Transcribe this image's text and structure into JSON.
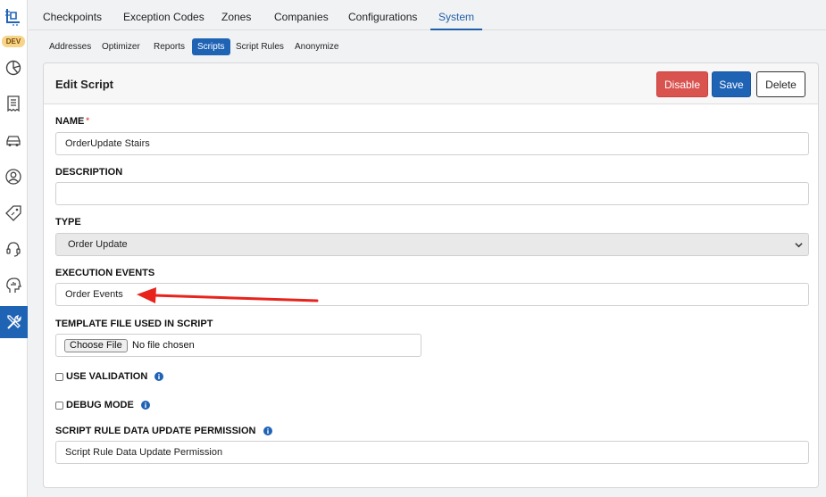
{
  "sidebar": {
    "badge": "DEV",
    "icons": [
      "logo-icon",
      "pie-chart-icon",
      "receipt-icon",
      "car-icon",
      "user-circle-icon",
      "price-tag-icon",
      "headset-icon",
      "head-analytics-icon",
      "tools-icon"
    ]
  },
  "top_tabs": [
    "Checkpoints",
    "Exception Codes",
    "Zones",
    "Companies",
    "Configurations",
    "System"
  ],
  "top_tabs_active": "System",
  "sub_tabs": [
    "Addresses",
    "Optimizer",
    "Reports",
    "Scripts",
    "Script Rules",
    "Anonymize"
  ],
  "sub_tabs_active": "Scripts",
  "card": {
    "title": "Edit Script",
    "disable_label": "Disable",
    "save_label": "Save",
    "delete_label": "Delete"
  },
  "form": {
    "name_label": "NAME",
    "name_required": "*",
    "name_value": "OrderUpdate Stairs",
    "description_label": "DESCRIPTION",
    "description_value": "",
    "type_label": "TYPE",
    "type_value": "Order Update",
    "events_label": "EXECUTION EVENTS",
    "events_value": "Order Events",
    "template_label": "TEMPLATE FILE USED IN SCRIPT",
    "file_button": "Choose File",
    "file_status": "No file chosen",
    "use_validation_label": "USE VALIDATION",
    "debug_mode_label": "DEBUG MODE",
    "permission_label": "SCRIPT RULE DATA UPDATE PERMISSION",
    "permission_value": "Script Rule Data Update Permission"
  },
  "colors": {
    "primary": "#1f63b5",
    "danger": "#d9534f",
    "annotation_arrow": "#e8231c",
    "badge": "#f6d58a"
  }
}
